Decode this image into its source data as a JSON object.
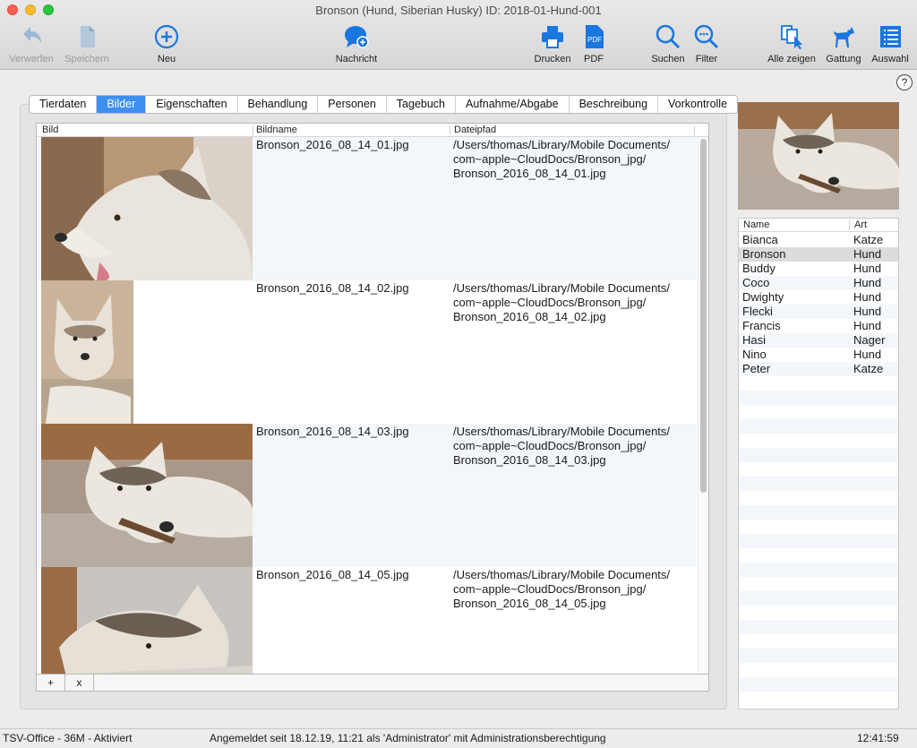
{
  "window": {
    "title": "Bronson (Hund, Siberian Husky) ID: 2018-01-Hund-001"
  },
  "toolbar": {
    "verwerfen": "Verwerfen",
    "speichern": "Speichern",
    "neu": "Neu",
    "nachricht": "Nachricht",
    "drucken": "Drucken",
    "pdf": "PDF",
    "suchen": "Suchen",
    "filter": "Filter",
    "alle_zeigen": "Alle zeigen",
    "gattung": "Gattung",
    "auswahl": "Auswahl",
    "accent": "#1a76e0"
  },
  "help_label": "?",
  "tabs": [
    {
      "label": "Tierdaten"
    },
    {
      "label": "Bilder"
    },
    {
      "label": "Eigenschaften"
    },
    {
      "label": "Behandlung"
    },
    {
      "label": "Personen"
    },
    {
      "label": "Tagebuch"
    },
    {
      "label": "Aufnahme/Abgabe"
    },
    {
      "label": "Beschreibung"
    },
    {
      "label": "Vorkontrolle"
    }
  ],
  "images_table": {
    "headers": {
      "bild": "Bild",
      "bildname": "Bildname",
      "dateipfad": "Dateipfad"
    },
    "rows": [
      {
        "name": "Bronson_2016_08_14_01.jpg",
        "path1": "/Users/thomas/Library/Mobile Documents/",
        "path2": "com~apple~CloudDocs/Bronson_jpg/",
        "path3": "Bronson_2016_08_14_01.jpg"
      },
      {
        "name": "Bronson_2016_08_14_02.jpg",
        "path1": "/Users/thomas/Library/Mobile Documents/",
        "path2": "com~apple~CloudDocs/Bronson_jpg/",
        "path3": "Bronson_2016_08_14_02.jpg"
      },
      {
        "name": "Bronson_2016_08_14_03.jpg",
        "path1": "/Users/thomas/Library/Mobile Documents/",
        "path2": "com~apple~CloudDocs/Bronson_jpg/",
        "path3": "Bronson_2016_08_14_03.jpg"
      },
      {
        "name": "Bronson_2016_08_14_05.jpg",
        "path1": "/Users/thomas/Library/Mobile Documents/",
        "path2": "com~apple~CloudDocs/Bronson_jpg/",
        "path3": "Bronson_2016_08_14_05.jpg"
      }
    ],
    "add_label": "+",
    "remove_label": "x"
  },
  "animal_list": {
    "headers": {
      "name": "Name",
      "art": "Art"
    },
    "rows": [
      {
        "name": "Bianca",
        "art": "Katze"
      },
      {
        "name": "Bronson",
        "art": "Hund"
      },
      {
        "name": "Buddy",
        "art": "Hund"
      },
      {
        "name": "Coco",
        "art": "Hund"
      },
      {
        "name": "Dwighty",
        "art": "Hund"
      },
      {
        "name": "Flecki",
        "art": "Hund"
      },
      {
        "name": "Francis",
        "art": "Hund"
      },
      {
        "name": "Hasi",
        "art": "Nager"
      },
      {
        "name": "Nino",
        "art": "Hund"
      },
      {
        "name": "Peter",
        "art": "Katze"
      }
    ]
  },
  "status": {
    "left": "TSV-Office - 36M - Aktiviert",
    "center": "Angemeldet seit 18.12.19, 11:21 als 'Administrator' mit Administrationsberechtigung",
    "right": "12:41:59"
  }
}
